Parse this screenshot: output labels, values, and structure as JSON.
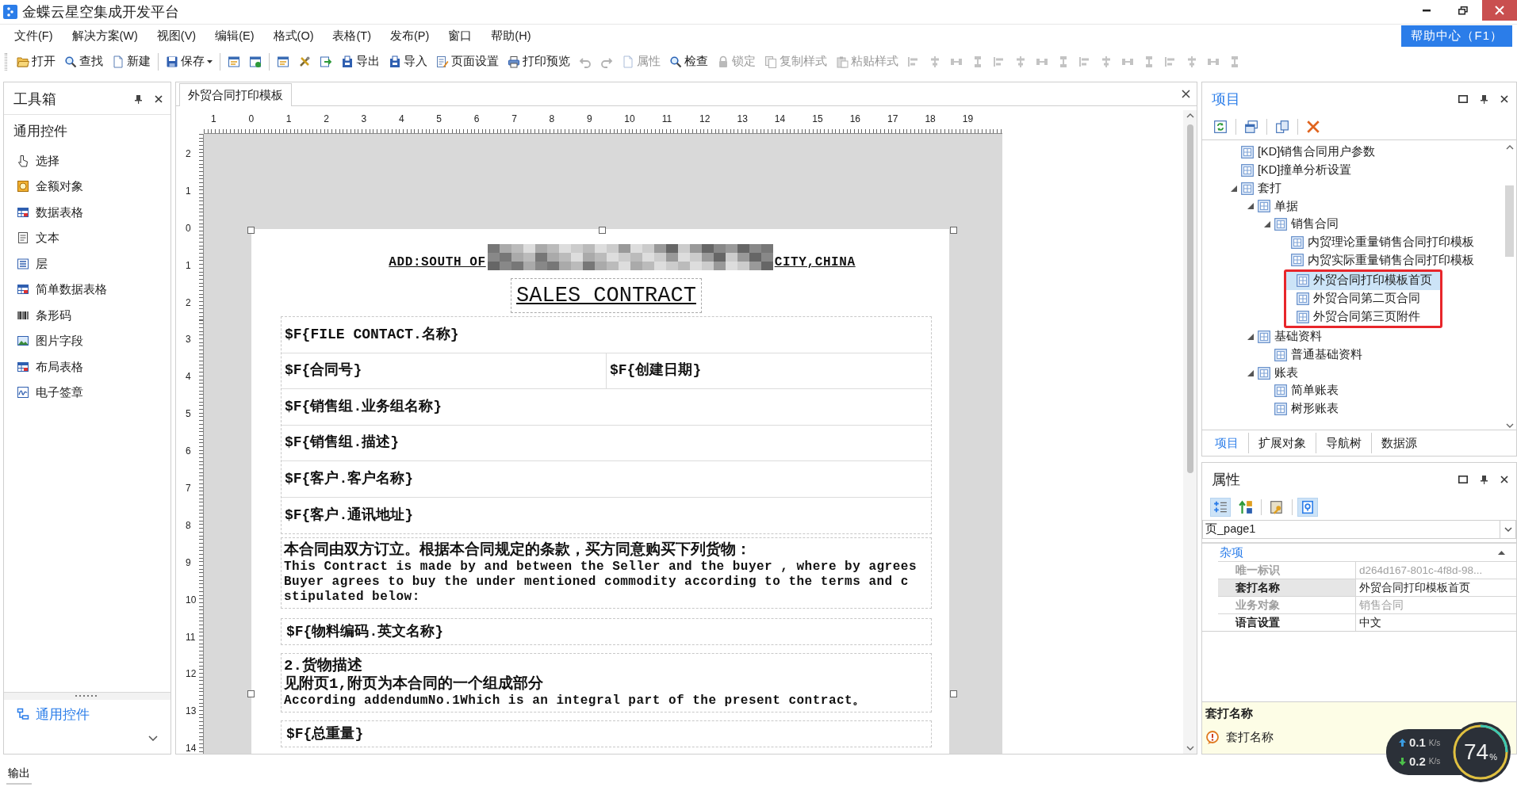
{
  "window": {
    "title": "金蝶云星空集成开发平台"
  },
  "menu": [
    "文件(F)",
    "解决方案(W)",
    "视图(V)",
    "编辑(E)",
    "格式(O)",
    "表格(T)",
    "发布(P)",
    "窗口",
    "帮助(H)"
  ],
  "help_button": "帮助中心（F1）",
  "toolbar": [
    {
      "kind": "button",
      "label": "打开",
      "disabled": false
    },
    {
      "kind": "button",
      "label": "查找",
      "disabled": false
    },
    {
      "kind": "button",
      "label": "新建",
      "disabled": false
    },
    {
      "kind": "separator"
    },
    {
      "kind": "dropdown",
      "label": "保存",
      "disabled": false
    },
    {
      "kind": "separator"
    },
    {
      "kind": "icon",
      "disabled": false
    },
    {
      "kind": "icon",
      "disabled": false
    },
    {
      "kind": "separator"
    },
    {
      "kind": "icon",
      "disabled": false
    },
    {
      "kind": "icon",
      "disabled": false
    },
    {
      "kind": "icon",
      "disabled": false
    },
    {
      "kind": "button",
      "label": "导出",
      "disabled": false
    },
    {
      "kind": "button",
      "label": "导入",
      "disabled": false
    },
    {
      "kind": "button",
      "label": "页面设置",
      "disabled": false
    },
    {
      "kind": "button",
      "label": "打印预览",
      "disabled": false
    },
    {
      "kind": "icon",
      "disabled": true
    },
    {
      "kind": "icon",
      "disabled": true
    },
    {
      "kind": "button",
      "label": "属性",
      "disabled": true
    },
    {
      "kind": "button",
      "label": "检查",
      "disabled": false
    },
    {
      "kind": "button",
      "label": "锁定",
      "disabled": true
    },
    {
      "kind": "button",
      "label": "复制样式",
      "disabled": true
    },
    {
      "kind": "button",
      "label": "粘贴样式",
      "disabled": true
    },
    {
      "kind": "icon",
      "disabled": true
    },
    {
      "kind": "icon",
      "disabled": true
    },
    {
      "kind": "icon",
      "disabled": true
    },
    {
      "kind": "icon",
      "disabled": true
    },
    {
      "kind": "icon",
      "disabled": true
    },
    {
      "kind": "icon",
      "disabled": true
    },
    {
      "kind": "icon",
      "disabled": true
    },
    {
      "kind": "icon",
      "disabled": true
    },
    {
      "kind": "icon",
      "disabled": true
    },
    {
      "kind": "icon",
      "disabled": true
    },
    {
      "kind": "icon",
      "disabled": true
    },
    {
      "kind": "icon",
      "disabled": true
    },
    {
      "kind": "icon",
      "disabled": true
    },
    {
      "kind": "icon",
      "disabled": true
    },
    {
      "kind": "icon",
      "disabled": true
    },
    {
      "kind": "icon",
      "disabled": true
    }
  ],
  "toolbox": {
    "title": "工具箱",
    "section": "通用控件",
    "items": [
      "选择",
      "金额对象",
      "数据表格",
      "文本",
      "层",
      "简单数据表格",
      "条形码",
      "图片字段",
      "布局表格",
      "电子签章"
    ],
    "footer_link": "通用控件"
  },
  "document": {
    "tab": {
      "label": "外贸合同打印模板",
      "selected": true
    },
    "ruler": {
      "horizontal": [
        "1",
        "0",
        "1",
        "2",
        "3",
        "4",
        "5",
        "6",
        "7",
        "8",
        "9",
        "10",
        "11",
        "12",
        "13",
        "14",
        "15",
        "16",
        "17",
        "18",
        "19"
      ],
      "vertical": [
        "2",
        "1",
        "0",
        "1",
        "2",
        "3",
        "4",
        "5",
        "6",
        "7",
        "8",
        "9",
        "10",
        "11",
        "12",
        "13",
        "14"
      ]
    },
    "page": {
      "address_start": "ADD:SOUTH OF",
      "address_end": "CITY,CHINA",
      "title": "SALES CONTRACT",
      "fields": [
        {
          "cells": [
            "$F{FILE CONTACT.名称}"
          ]
        },
        {
          "cells": [
            "$F{合同号}",
            "$F{创建日期}"
          ]
        },
        {
          "cells": [
            "$F{销售组.业务组名称}"
          ]
        },
        {
          "cells": [
            "$F{销售组.描述}"
          ]
        },
        {
          "cells": [
            "$F{客户.客户名称}"
          ]
        },
        {
          "cells": [
            "$F{客户.通讯地址}"
          ]
        }
      ],
      "intro_lines": [
        "本合同由双方订立。根据本合同规定的条款，买方同意购买下列货物：",
        "This Contract is made by and between the Seller and the buyer , where by agrees",
        "Buyer agrees to buy the under mentioned commodity according to the terms and c",
        "stipulated below:"
      ],
      "material_field": "$F{物料编码.英文名称}",
      "description_lines": [
        "2.货物描述",
        "见附页1,附页为本合同的一个组成部分",
        "According addendumNo.1Which is an integral part of the present contract。"
      ],
      "weight_field": "$F{总重量}"
    }
  },
  "project_panel": {
    "title": "项目",
    "tree": [
      {
        "label": "[KD]销售合同用户参数",
        "selected": false,
        "marked": false
      },
      {
        "label": "[KD]撞单分析设置",
        "selected": false,
        "marked": false
      },
      {
        "label": "套打",
        "expanded": true,
        "selected": false,
        "marked": false,
        "children": [
          {
            "label": "单据",
            "expanded": true,
            "selected": false,
            "marked": false,
            "children": [
              {
                "label": "销售合同",
                "expanded": true,
                "selected": false,
                "marked": false,
                "children": [
                  {
                    "label": "内贸理论重量销售合同打印模板",
                    "selected": false,
                    "marked": false
                  },
                  {
                    "label": "内贸实际重量销售合同打印模板",
                    "selected": false,
                    "marked": false
                  },
                  {
                    "label": "外贸合同打印模板首页",
                    "selected": true,
                    "marked": true
                  },
                  {
                    "label": "外贸合同第二页合同",
                    "selected": false,
                    "marked": true
                  },
                  {
                    "label": "外贸合同第三页附件",
                    "selected": false,
                    "marked": true
                  }
                ]
              }
            ]
          },
          {
            "label": "基础资料",
            "expanded": true,
            "selected": false,
            "marked": false,
            "children": [
              {
                "label": "普通基础资料",
                "selected": false,
                "marked": false
              }
            ]
          },
          {
            "label": "账表",
            "expanded": true,
            "selected": false,
            "marked": false,
            "children": [
              {
                "label": "简单账表",
                "selected": false,
                "marked": false
              },
              {
                "label": "树形账表",
                "selected": false,
                "marked": false
              }
            ]
          }
        ]
      }
    ],
    "tabs": [
      {
        "label": "项目",
        "selected": true
      },
      {
        "label": "扩展对象",
        "selected": false
      },
      {
        "label": "导航树",
        "selected": false
      },
      {
        "label": "数据源",
        "selected": false
      }
    ]
  },
  "properties_panel": {
    "title": "属性",
    "tools": [
      {
        "on": true
      },
      {
        "on": false
      },
      {
        "on": false
      },
      {
        "on": true
      }
    ],
    "object": "页_page1",
    "category": {
      "label": "杂项",
      "expanded": true
    },
    "rows": [
      {
        "label": "唯一标识",
        "value": "d264d167-801c-4f8d-98...",
        "disabled": true,
        "selected": false
      },
      {
        "label": "套打名称",
        "value": "外贸合同打印模板首页",
        "disabled": false,
        "selected": true
      },
      {
        "label": "业务对象",
        "value": "销售合同",
        "disabled": true,
        "selected": false
      },
      {
        "label": "语言设置",
        "value": "中文",
        "disabled": false,
        "selected": false
      }
    ],
    "description": {
      "title": "套打名称",
      "text": "套打名称"
    }
  },
  "output_tab": "输出",
  "network_widget": {
    "upload": "0.1",
    "upload_unit": "K/s",
    "download": "0.2",
    "download_unit": "K/s",
    "usage": "74",
    "usage_unit": "%"
  }
}
